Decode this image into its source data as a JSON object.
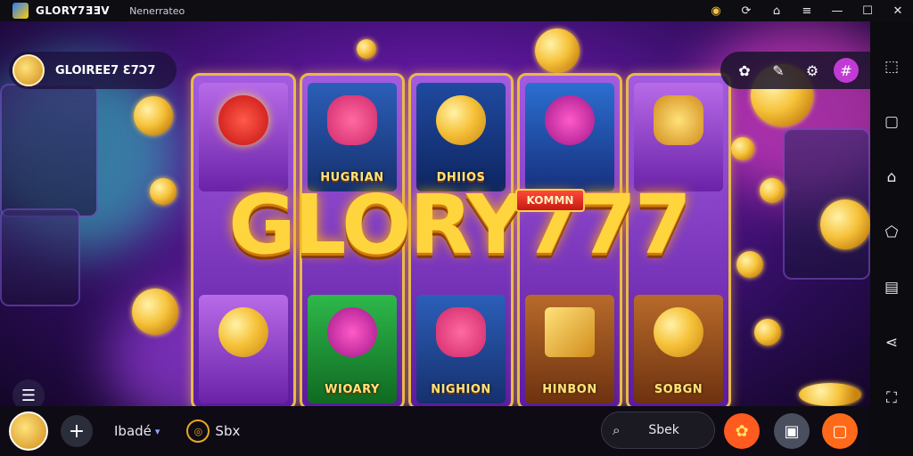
{
  "window": {
    "title": "GLORY7ƎƎV",
    "subtitle": "Nenerrateo",
    "controls": [
      "coin-icon",
      "refresh-icon",
      "home-icon",
      "menu-icon",
      "minimize-icon",
      "maximize-icon",
      "close-icon"
    ]
  },
  "game": {
    "player_name": "GLOIREE7 Ɛ7Ɔ7",
    "brand": "GLORY777",
    "badge": "KOMMN",
    "reels": [
      {
        "top": "",
        "bottom": ""
      },
      {
        "top": "HUGRIAN",
        "bottom": "WIOARY"
      },
      {
        "top": "DHIIOS",
        "bottom": "NIGHION"
      },
      {
        "top": "",
        "bottom": "HINBON"
      },
      {
        "top": "",
        "bottom": "SOBGN"
      }
    ],
    "top_tools": [
      "settings-icon",
      "pen-icon",
      "gear-icon",
      "grid-icon"
    ]
  },
  "bottombar": {
    "label_left": "Ibadé",
    "coin_label": "Sbx",
    "search_label": "Sbek"
  },
  "sidebar": {
    "items": [
      "screen-icon",
      "window-icon",
      "home-icon",
      "shape-icon",
      "image-icon",
      "share-icon",
      "expand-icon"
    ]
  },
  "colors": {
    "gold": "#ffd53d",
    "purple": "#5a1697",
    "orange_button": "#ff6a1a",
    "pink_button": "#c23ad6"
  }
}
